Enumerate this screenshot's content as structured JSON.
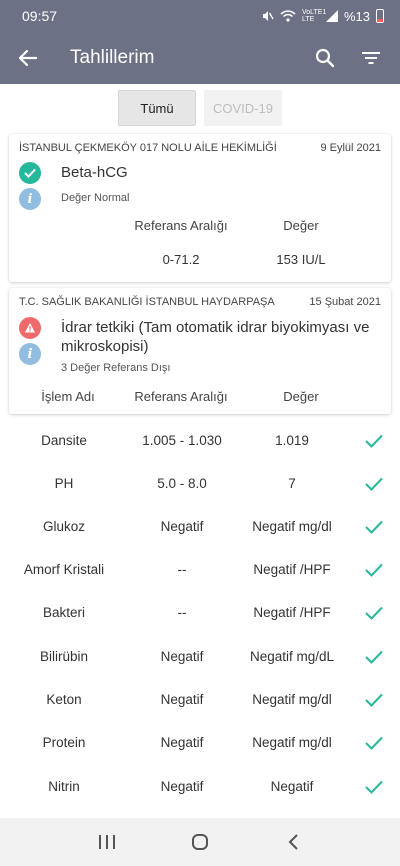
{
  "status": {
    "time": "09:57",
    "battery": "%13",
    "network": "VoLTE1 LTE"
  },
  "appbar": {
    "title": "Tahlillerim"
  },
  "tabs": [
    {
      "label": "Tümü",
      "active": true
    },
    {
      "label": "COVID-19",
      "active": false
    }
  ],
  "card1": {
    "institution": "İSTANBUL ÇEKMEKÖY 017 NOLU AİLE HEKİMLİĞİ",
    "date": "9 Eylül 2021",
    "test": "Beta-hCG",
    "status": "Değer Normal",
    "ref_header": "Referans Aralığı",
    "val_header": "Değer",
    "ref": "0-71.2",
    "value": "153 IU/L"
  },
  "card2": {
    "institution": "T.C. SAĞLIK BAKANLIĞI İSTANBUL HAYDARPAŞA",
    "date": "15 Şubat 2021",
    "test": "İdrar tetkiki (Tam otomatik idrar biyokimyası ve mikroskopisi)",
    "status": "3 Değer Referans Dışı",
    "h_name": "İşlem Adı",
    "h_ref": "Referans Aralığı",
    "h_val": "Değer"
  },
  "rows": [
    {
      "name": "Dansite",
      "ref": "1.005 - 1.030",
      "value": "1.019"
    },
    {
      "name": "PH",
      "ref": "5.0 - 8.0",
      "value": "7"
    },
    {
      "name": "Glukoz",
      "ref": "Negatif",
      "value": "Negatif mg/dl"
    },
    {
      "name": "Amorf Kristali",
      "ref": "--",
      "value": "Negatif /HPF"
    },
    {
      "name": "Bakteri",
      "ref": "--",
      "value": "Negatif /HPF"
    },
    {
      "name": "Bilirübin",
      "ref": "Negatif",
      "value": "Negatif mg/dL"
    },
    {
      "name": "Keton",
      "ref": "Negatif",
      "value": "Negatif mg/dl"
    },
    {
      "name": "Protein",
      "ref": "Negatif",
      "value": "Negatif mg/dl"
    },
    {
      "name": "Nitrin",
      "ref": "Negatif",
      "value": "Negatif"
    }
  ],
  "colors": {
    "appbar": "#6d7185",
    "ok": "#26b89a",
    "warn": "#ef6b6b",
    "info": "#90bde0"
  }
}
